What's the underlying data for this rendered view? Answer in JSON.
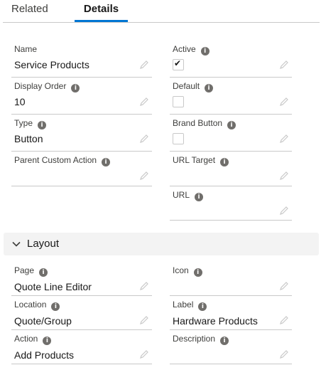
{
  "tabs": {
    "related": "Related",
    "details": "Details"
  },
  "fields": {
    "name": {
      "label": "Name",
      "value": "Service Products"
    },
    "active": {
      "label": "Active",
      "checked": true,
      "mark": "✔"
    },
    "display_order": {
      "label": "Display Order",
      "value": "10"
    },
    "default": {
      "label": "Default",
      "checked": false
    },
    "type": {
      "label": "Type",
      "value": "Button"
    },
    "brand_button": {
      "label": "Brand Button",
      "checked": false
    },
    "parent_custom_action": {
      "label": "Parent Custom Action",
      "value": ""
    },
    "url_target": {
      "label": "URL Target",
      "value": ""
    },
    "url": {
      "label": "URL",
      "value": ""
    }
  },
  "layout_section": {
    "title": "Layout",
    "fields": {
      "page": {
        "label": "Page",
        "value": "Quote Line Editor"
      },
      "icon": {
        "label": "Icon",
        "value": ""
      },
      "location": {
        "label": "Location",
        "value": "Quote/Group"
      },
      "label": {
        "label": "Label",
        "value": "Hardware Products"
      },
      "action": {
        "label": "Action",
        "value": "Add Products"
      },
      "description": {
        "label": "Description",
        "value": ""
      }
    }
  },
  "icons": {
    "info": "info-icon",
    "edit": "pencil-icon",
    "collapse": "chevron-down-icon"
  },
  "colors": {
    "accent": "#0176d3",
    "border": "#c9c9c9",
    "section_bg": "#f3f3f3"
  }
}
